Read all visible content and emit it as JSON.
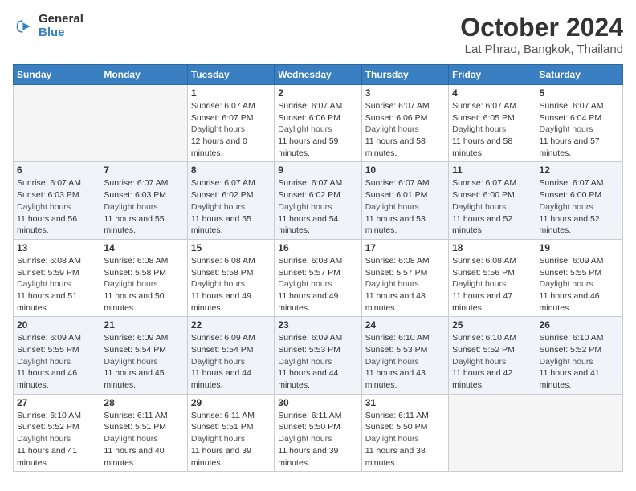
{
  "header": {
    "logo_line1": "General",
    "logo_line2": "Blue",
    "month": "October 2024",
    "location": "Lat Phrao, Bangkok, Thailand"
  },
  "weekdays": [
    "Sunday",
    "Monday",
    "Tuesday",
    "Wednesday",
    "Thursday",
    "Friday",
    "Saturday"
  ],
  "weeks": [
    [
      {
        "day": "",
        "empty": true
      },
      {
        "day": "",
        "empty": true
      },
      {
        "day": "1",
        "sunrise": "6:07 AM",
        "sunset": "6:07 PM",
        "daylight": "12 hours and 0 minutes."
      },
      {
        "day": "2",
        "sunrise": "6:07 AM",
        "sunset": "6:06 PM",
        "daylight": "11 hours and 59 minutes."
      },
      {
        "day": "3",
        "sunrise": "6:07 AM",
        "sunset": "6:06 PM",
        "daylight": "11 hours and 58 minutes."
      },
      {
        "day": "4",
        "sunrise": "6:07 AM",
        "sunset": "6:05 PM",
        "daylight": "11 hours and 58 minutes."
      },
      {
        "day": "5",
        "sunrise": "6:07 AM",
        "sunset": "6:04 PM",
        "daylight": "11 hours and 57 minutes."
      }
    ],
    [
      {
        "day": "6",
        "sunrise": "6:07 AM",
        "sunset": "6:03 PM",
        "daylight": "11 hours and 56 minutes."
      },
      {
        "day": "7",
        "sunrise": "6:07 AM",
        "sunset": "6:03 PM",
        "daylight": "11 hours and 55 minutes."
      },
      {
        "day": "8",
        "sunrise": "6:07 AM",
        "sunset": "6:02 PM",
        "daylight": "11 hours and 55 minutes."
      },
      {
        "day": "9",
        "sunrise": "6:07 AM",
        "sunset": "6:02 PM",
        "daylight": "11 hours and 54 minutes."
      },
      {
        "day": "10",
        "sunrise": "6:07 AM",
        "sunset": "6:01 PM",
        "daylight": "11 hours and 53 minutes."
      },
      {
        "day": "11",
        "sunrise": "6:07 AM",
        "sunset": "6:00 PM",
        "daylight": "11 hours and 52 minutes."
      },
      {
        "day": "12",
        "sunrise": "6:07 AM",
        "sunset": "6:00 PM",
        "daylight": "11 hours and 52 minutes."
      }
    ],
    [
      {
        "day": "13",
        "sunrise": "6:08 AM",
        "sunset": "5:59 PM",
        "daylight": "11 hours and 51 minutes."
      },
      {
        "day": "14",
        "sunrise": "6:08 AM",
        "sunset": "5:58 PM",
        "daylight": "11 hours and 50 minutes."
      },
      {
        "day": "15",
        "sunrise": "6:08 AM",
        "sunset": "5:58 PM",
        "daylight": "11 hours and 49 minutes."
      },
      {
        "day": "16",
        "sunrise": "6:08 AM",
        "sunset": "5:57 PM",
        "daylight": "11 hours and 49 minutes."
      },
      {
        "day": "17",
        "sunrise": "6:08 AM",
        "sunset": "5:57 PM",
        "daylight": "11 hours and 48 minutes."
      },
      {
        "day": "18",
        "sunrise": "6:08 AM",
        "sunset": "5:56 PM",
        "daylight": "11 hours and 47 minutes."
      },
      {
        "day": "19",
        "sunrise": "6:09 AM",
        "sunset": "5:55 PM",
        "daylight": "11 hours and 46 minutes."
      }
    ],
    [
      {
        "day": "20",
        "sunrise": "6:09 AM",
        "sunset": "5:55 PM",
        "daylight": "11 hours and 46 minutes."
      },
      {
        "day": "21",
        "sunrise": "6:09 AM",
        "sunset": "5:54 PM",
        "daylight": "11 hours and 45 minutes."
      },
      {
        "day": "22",
        "sunrise": "6:09 AM",
        "sunset": "5:54 PM",
        "daylight": "11 hours and 44 minutes."
      },
      {
        "day": "23",
        "sunrise": "6:09 AM",
        "sunset": "5:53 PM",
        "daylight": "11 hours and 44 minutes."
      },
      {
        "day": "24",
        "sunrise": "6:10 AM",
        "sunset": "5:53 PM",
        "daylight": "11 hours and 43 minutes."
      },
      {
        "day": "25",
        "sunrise": "6:10 AM",
        "sunset": "5:52 PM",
        "daylight": "11 hours and 42 minutes."
      },
      {
        "day": "26",
        "sunrise": "6:10 AM",
        "sunset": "5:52 PM",
        "daylight": "11 hours and 41 minutes."
      }
    ],
    [
      {
        "day": "27",
        "sunrise": "6:10 AM",
        "sunset": "5:52 PM",
        "daylight": "11 hours and 41 minutes."
      },
      {
        "day": "28",
        "sunrise": "6:11 AM",
        "sunset": "5:51 PM",
        "daylight": "11 hours and 40 minutes."
      },
      {
        "day": "29",
        "sunrise": "6:11 AM",
        "sunset": "5:51 PM",
        "daylight": "11 hours and 39 minutes."
      },
      {
        "day": "30",
        "sunrise": "6:11 AM",
        "sunset": "5:50 PM",
        "daylight": "11 hours and 39 minutes."
      },
      {
        "day": "31",
        "sunrise": "6:11 AM",
        "sunset": "5:50 PM",
        "daylight": "11 hours and 38 minutes."
      },
      {
        "day": "",
        "empty": true
      },
      {
        "day": "",
        "empty": true
      }
    ]
  ],
  "labels": {
    "sunrise": "Sunrise:",
    "sunset": "Sunset:",
    "daylight": "Daylight hours"
  }
}
